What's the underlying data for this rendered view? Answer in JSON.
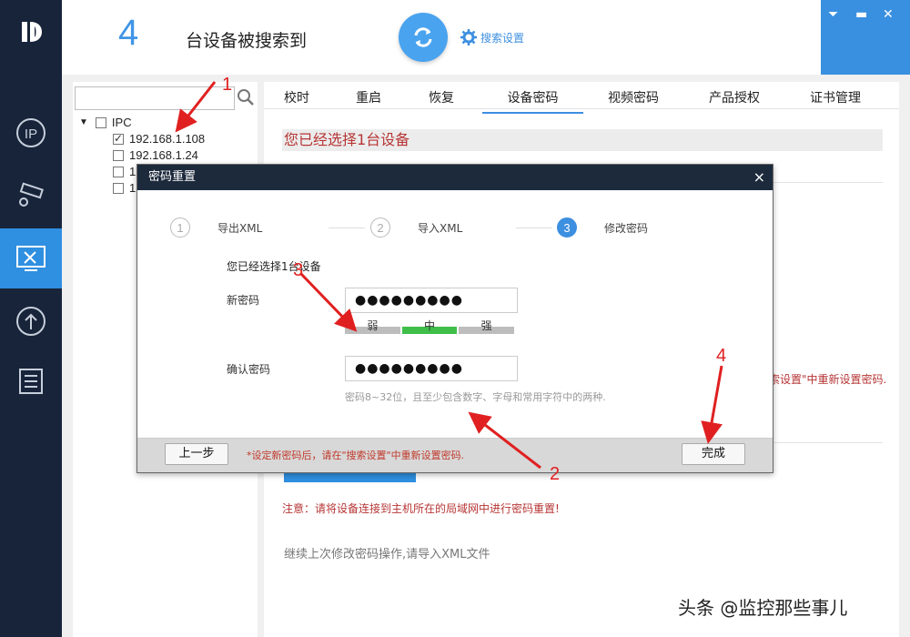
{
  "header": {
    "device_count": "4",
    "found_text": "台设备被搜索到",
    "search_settings_label": "搜索设置"
  },
  "tree": {
    "root_label": "IPC",
    "items": [
      {
        "label": "192.168.1.108",
        "checked": true
      },
      {
        "label": "192.168.1.24",
        "checked": false
      },
      {
        "label": "1",
        "checked": false
      },
      {
        "label": "1",
        "checked": false
      }
    ]
  },
  "tabs": [
    "校时",
    "重启",
    "恢复",
    "设备密码",
    "视频密码",
    "产品授权",
    "证书管理"
  ],
  "active_tab": "设备密码",
  "content": {
    "selected_text": "您已经选择1台设备",
    "hint_right": "索设置\"中重新设置密码.",
    "note": "注意：请将设备连接到主机所在的局域网中进行密码重置!",
    "continue_text": "继续上次修改密码操作,请导入XML文件"
  },
  "dialog": {
    "title": "密码重置",
    "close": "×",
    "steps": [
      {
        "num": "1",
        "label": "导出XML"
      },
      {
        "num": "2",
        "label": "导入XML"
      },
      {
        "num": "3",
        "label": "修改密码"
      }
    ],
    "selected_text": "您已经选择1台设备",
    "new_password_label": "新密码",
    "new_password_value": "●●●●●●●●●",
    "strength": [
      "弱",
      "中",
      "强"
    ],
    "strength_level": "中",
    "confirm_label": "确认密码",
    "confirm_value": "●●●●●●●●●",
    "rule": "密码8~32位，且至少包含数字、字母和常用字符中的两种.",
    "prev_button": "上一步",
    "footer_hint": "*设定新密码后，请在\"搜索设置\"中重新设置密码.",
    "done_button": "完成"
  },
  "annotations": [
    "1",
    "2",
    "3",
    "4"
  ],
  "watermark": "头条 @监控那些事儿",
  "colors": {
    "accent": "#3d8fe0",
    "rail": "#17243a",
    "warning_red": "#b73535",
    "strength_green": "#3fbf4a",
    "annotation_red": "#e02020"
  }
}
